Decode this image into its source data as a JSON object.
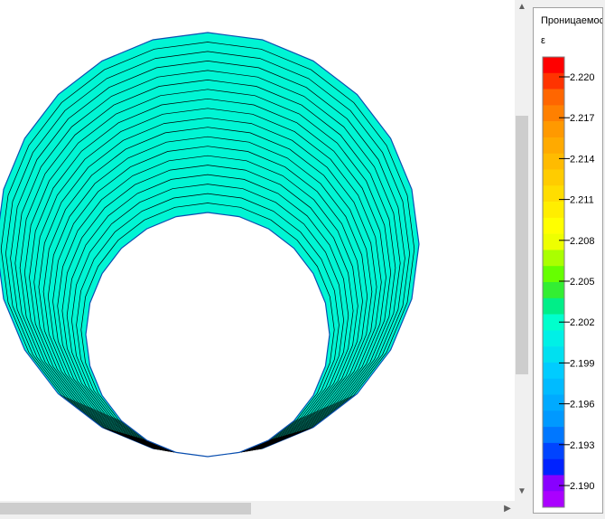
{
  "legend": {
    "title": "Проницаемос",
    "symbol": "ε",
    "ticks": [
      "2.220",
      "2.217",
      "2.214",
      "2.211",
      "2.208",
      "2.205",
      "2.202",
      "2.199",
      "2.196",
      "2.193",
      "2.190"
    ],
    "colors": [
      "#ff0000",
      "#ff3300",
      "#ff6600",
      "#ff8000",
      "#ff9900",
      "#ffaa00",
      "#ffbb00",
      "#ffcc00",
      "#ffdd00",
      "#ffee00",
      "#ffff00",
      "#eeff00",
      "#aaff00",
      "#66ff00",
      "#33ee33",
      "#00ee88",
      "#00ffcc",
      "#00f0e6",
      "#00e0f0",
      "#00ccff",
      "#00bbff",
      "#00aaff",
      "#0099ff",
      "#0077ff",
      "#0044ff",
      "#0022ff",
      "#8800ff",
      "#aa00ff"
    ]
  },
  "plot": {
    "fill_color": "#00f5d4",
    "line_color": "#000000",
    "rings": 19
  },
  "scrollbars": {
    "up_arrow": "▲",
    "down_arrow": "▼",
    "left_arrow": "◀",
    "right_arrow": "▶"
  }
}
